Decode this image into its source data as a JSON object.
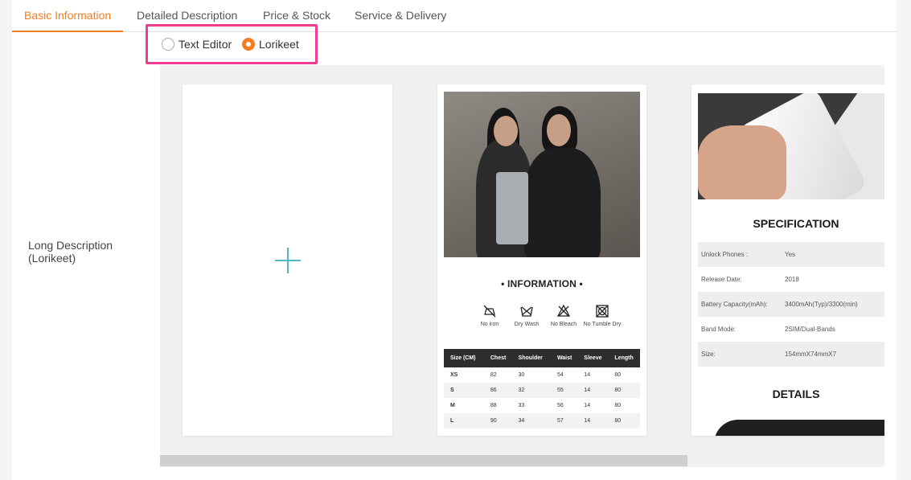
{
  "tabs": [
    {
      "label": "Basic Information",
      "active": true
    },
    {
      "label": "Detailed Description",
      "active": false
    },
    {
      "label": "Price & Stock",
      "active": false
    },
    {
      "label": "Service & Delivery",
      "active": false
    }
  ],
  "editor_mode": {
    "options": [
      {
        "label": "Text Editor",
        "checked": false
      },
      {
        "label": "Lorikeet",
        "checked": true
      }
    ]
  },
  "field": {
    "label_line1": "Long Description",
    "label_line2": "(Lorikeet)"
  },
  "templates": {
    "add_icon": "plus-icon",
    "fashion": {
      "section_title": "• INFORMATION •",
      "care_labels": [
        "No iron",
        "Dry Wash",
        "No Bleach",
        "No Tumble Dry"
      ],
      "size_table": {
        "headers": [
          "Size (CM)",
          "Chest",
          "Shoulder",
          "Waist",
          "Sleeve",
          "Length"
        ],
        "rows": [
          [
            "XS",
            "82",
            "30",
            "54",
            "14",
            "80"
          ],
          [
            "S",
            "86",
            "32",
            "55",
            "14",
            "80"
          ],
          [
            "M",
            "88",
            "33",
            "56",
            "14",
            "80"
          ],
          [
            "L",
            "90",
            "34",
            "57",
            "14",
            "80"
          ]
        ]
      }
    },
    "spec": {
      "section_title": "SPECIFICATION",
      "rows": [
        [
          "Unlock Phones :",
          "Yes"
        ],
        [
          "Release Date:",
          "2018"
        ],
        [
          "Battery Capacity(mAh):",
          "3400mAh(Typ)/3300(min)"
        ],
        [
          "Band Mode:",
          "2SIM/Dual-Bands"
        ],
        [
          "Size:",
          "154mmX74mmX7"
        ]
      ],
      "details_title": "DETAILS"
    }
  },
  "colors": {
    "accent": "#f57c1f",
    "highlight_box": "#ee3d8f",
    "add_icon": "#4fb8c9"
  }
}
